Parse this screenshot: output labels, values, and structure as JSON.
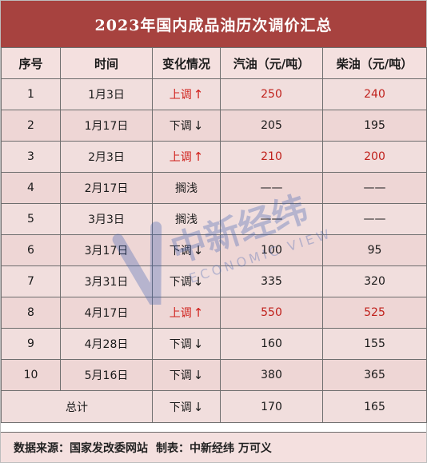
{
  "title": "2023年国内成品油历次调价汇总",
  "headers": [
    "序号",
    "时间",
    "变化情况",
    "汽油（元/吨）",
    "柴油（元/吨）"
  ],
  "rows": [
    {
      "no": "1",
      "date": "1月3日",
      "change": "上调",
      "arrow": "↑",
      "up": true,
      "gasoline": "250",
      "diesel": "240"
    },
    {
      "no": "2",
      "date": "1月17日",
      "change": "下调",
      "arrow": "↓",
      "up": false,
      "gasoline": "205",
      "diesel": "195"
    },
    {
      "no": "3",
      "date": "2月3日",
      "change": "上调",
      "arrow": "↑",
      "up": true,
      "gasoline": "210",
      "diesel": "200"
    },
    {
      "no": "4",
      "date": "2月17日",
      "change": "搁浅",
      "arrow": "",
      "up": false,
      "gasoline": "——",
      "diesel": "——"
    },
    {
      "no": "5",
      "date": "3月3日",
      "change": "搁浅",
      "arrow": "",
      "up": false,
      "gasoline": "——",
      "diesel": "——"
    },
    {
      "no": "6",
      "date": "3月17日",
      "change": "下调",
      "arrow": "↓",
      "up": false,
      "gasoline": "100",
      "diesel": "95"
    },
    {
      "no": "7",
      "date": "3月31日",
      "change": "下调",
      "arrow": "↓",
      "up": false,
      "gasoline": "335",
      "diesel": "320"
    },
    {
      "no": "8",
      "date": "4月17日",
      "change": "上调",
      "arrow": "↑",
      "up": true,
      "gasoline": "550",
      "diesel": "525"
    },
    {
      "no": "9",
      "date": "4月28日",
      "change": "下调",
      "arrow": "↓",
      "up": false,
      "gasoline": "160",
      "diesel": "155"
    },
    {
      "no": "10",
      "date": "5月16日",
      "change": "下调",
      "arrow": "↓",
      "up": false,
      "gasoline": "380",
      "diesel": "365"
    }
  ],
  "total": {
    "label": "总计",
    "change": "下调",
    "arrow": "↓",
    "gasoline": "170",
    "diesel": "165"
  },
  "footer": {
    "source": "数据来源：国家发改委网站",
    "maker": "制表：中新经纬 万可义"
  },
  "watermark": {
    "cn": "中新经纬",
    "en": "ECONOMIC VIEW"
  },
  "colors": {
    "title_bg": "#a7423f",
    "up_text": "#d0201b",
    "row_bg": "#f1dedd"
  }
}
